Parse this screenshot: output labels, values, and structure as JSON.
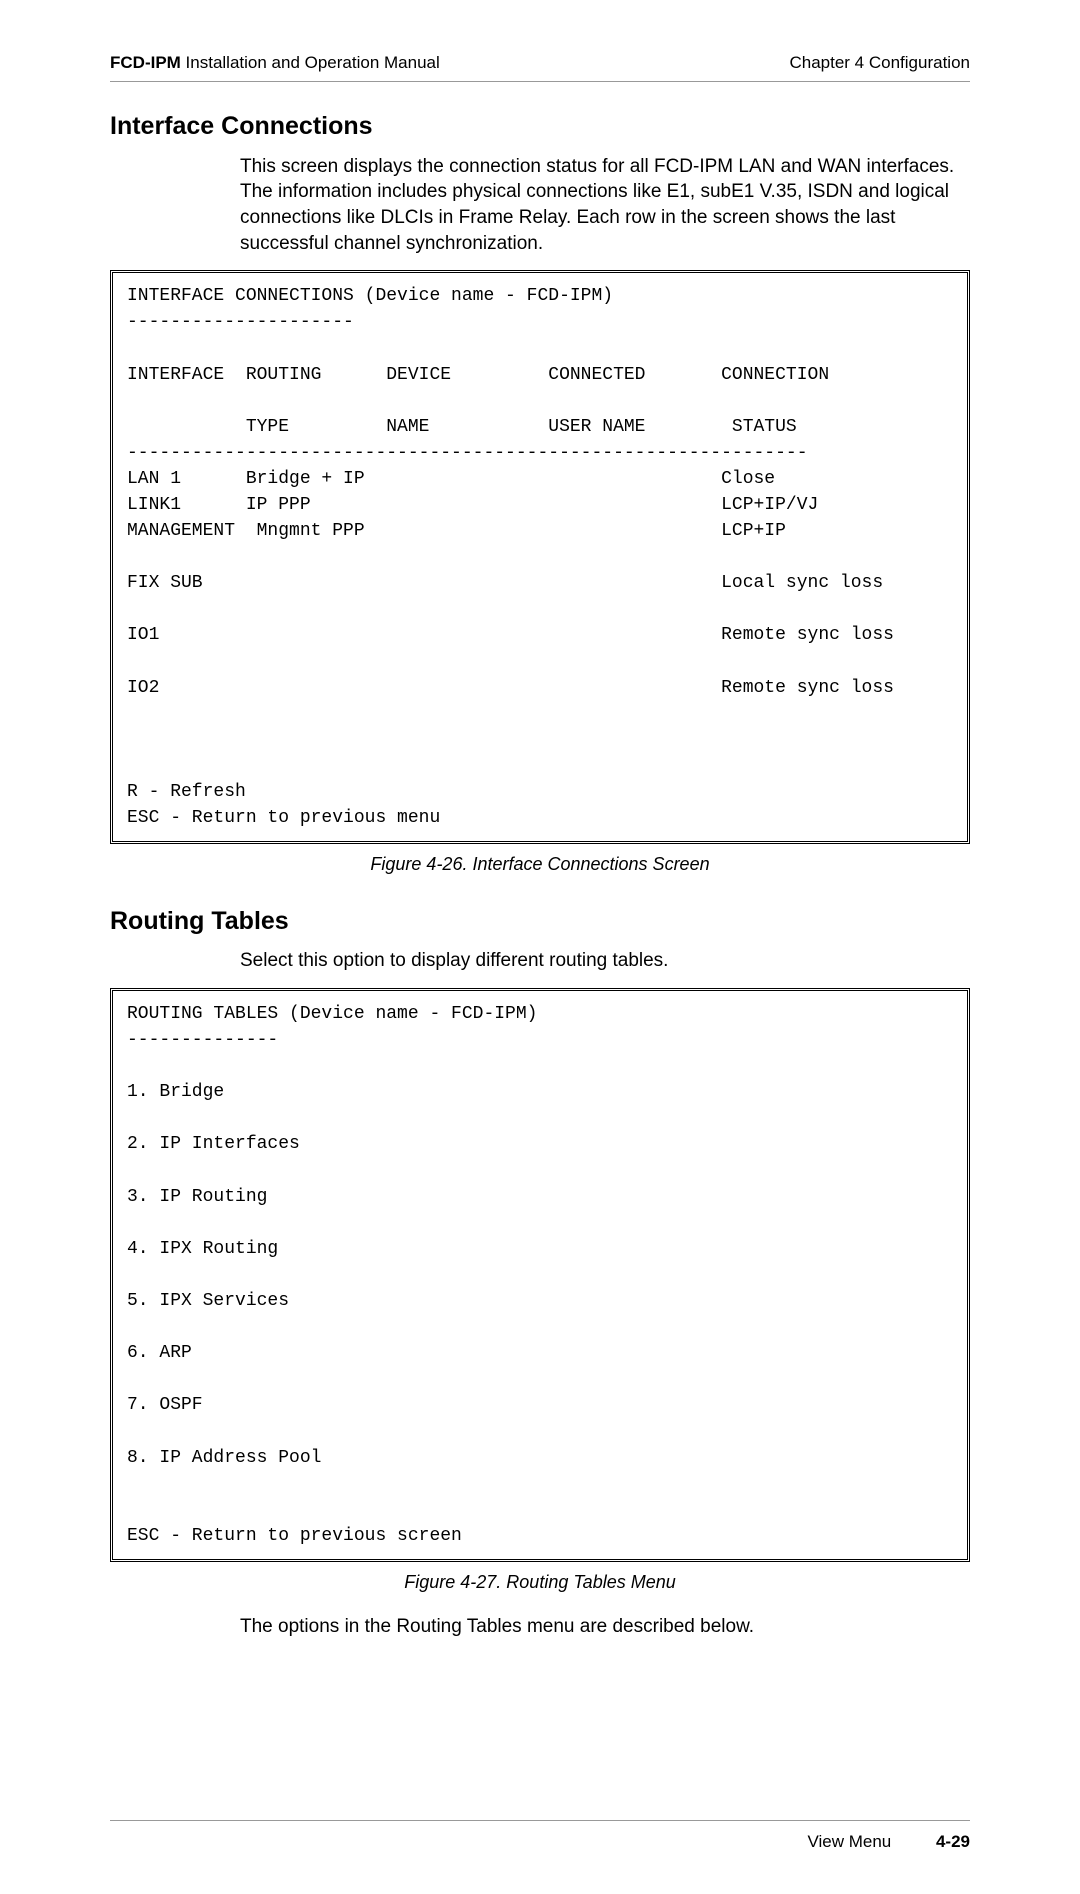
{
  "header": {
    "product_bold": "FCD-IPM",
    "product_rest": " Installation and Operation Manual",
    "chapter": "Chapter 4  Configuration"
  },
  "section1": {
    "title": "Interface Connections",
    "paragraph": "This screen displays the connection status for all FCD-IPM LAN and WAN interfaces. The information includes physical connections like E1, subE1 V.35, ISDN and logical connections like DLCIs in Frame Relay. Each row in the screen shows the last successful channel synchronization.",
    "terminal": "INTERFACE CONNECTIONS (Device name - FCD-IPM)\n---------------------\n\nINTERFACE  ROUTING      DEVICE         CONNECTED       CONNECTION\n\n           TYPE         NAME           USER NAME        STATUS\n---------------------------------------------------------------\nLAN 1      Bridge + IP                                 Close\nLINK1      IP PPP                                      LCP+IP/VJ\nMANAGEMENT  Mngmnt PPP                                 LCP+IP\n\nFIX SUB                                                Local sync loss\n\nIO1                                                    Remote sync loss\n\nIO2                                                    Remote sync loss\n\n\n\nR - Refresh\nESC - Return to previous menu",
    "caption": "Figure 4-26.  Interface Connections Screen"
  },
  "section2": {
    "title": "Routing Tables",
    "paragraph": "Select this option to display different routing tables.",
    "terminal": "ROUTING TABLES (Device name - FCD-IPM)\n--------------\n\n1. Bridge\n\n2. IP Interfaces\n\n3. IP Routing\n\n4. IPX Routing\n\n5. IPX Services\n\n6. ARP\n\n7. OSPF\n\n8. IP Address Pool\n\n\nESC - Return to previous screen",
    "caption": "Figure 4-27.  Routing Tables Menu",
    "after_text": "The options in the Routing Tables menu are described below."
  },
  "footer": {
    "label": "View Menu",
    "page": "4-29"
  }
}
